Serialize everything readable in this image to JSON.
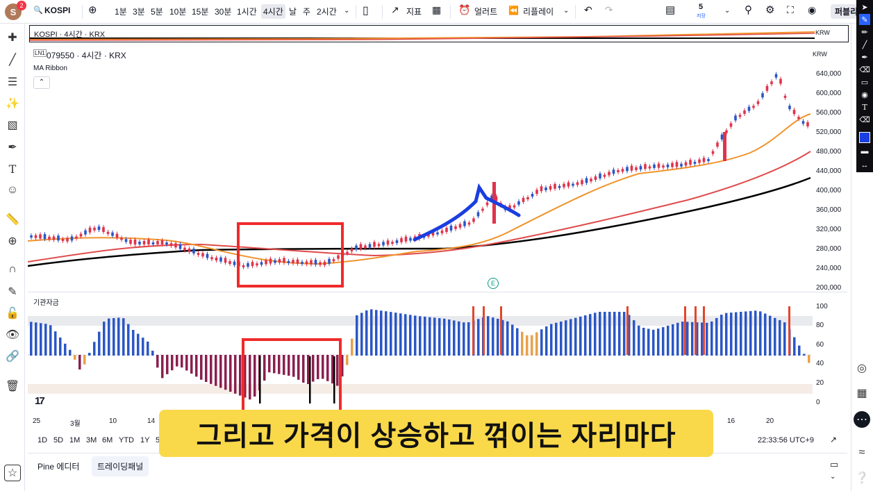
{
  "toolbar": {
    "avatar": "S",
    "badge": "2",
    "symbol": "KOSPI",
    "intervals": [
      "1분",
      "3분",
      "5분",
      "10분",
      "15분",
      "30분",
      "1시간",
      "4시간",
      "날",
      "주",
      "2시간"
    ],
    "active_interval": "4시간",
    "indicators": "지표",
    "alert": "얼러트",
    "replay": "리플레이",
    "save_count": "5",
    "save_label": "저장",
    "publish": "퍼블리"
  },
  "compare": {
    "title": "KOSPI · 4시간 · KRX",
    "currency": "KRW"
  },
  "main": {
    "legend_badge": "LN1",
    "title": "079550 · 4시간 · KRX",
    "indicator": "MA Ribbon",
    "currency": "KRW",
    "price_labels": [
      "640,000",
      "600,000",
      "560,000",
      "520,000",
      "480,000",
      "440,000",
      "400,000",
      "360,000",
      "320,000",
      "280,000",
      "240,000",
      "200,000"
    ]
  },
  "sub": {
    "title": "기관자금",
    "levels": [
      "100",
      "80",
      "60",
      "40",
      "20",
      "0"
    ]
  },
  "time_labels": [
    "25",
    "3월",
    "10",
    "14",
    "16",
    "20"
  ],
  "bottom": {
    "ranges": [
      "1D",
      "5D",
      "1M",
      "3M",
      "6M",
      "YTD",
      "1Y",
      "5"
    ],
    "clock": "22:33:56 UTC+9"
  },
  "panel": {
    "pine": "Pine 에디터",
    "trading": "트레이딩패널"
  },
  "subtitle": "그리고 가격이 상승하고 꺾이는 자리마다",
  "event_marker": "E",
  "colors": {
    "up": "#e0334b",
    "down": "#2a56c6",
    "ma_orange": "#f0932b",
    "ma_red": "#e04a4a",
    "ma_black": "#000000",
    "highlight_box": "#ef2b2b",
    "pen_stroke": "#1a3ee0",
    "subtitle_bg": "#f9d94a"
  }
}
